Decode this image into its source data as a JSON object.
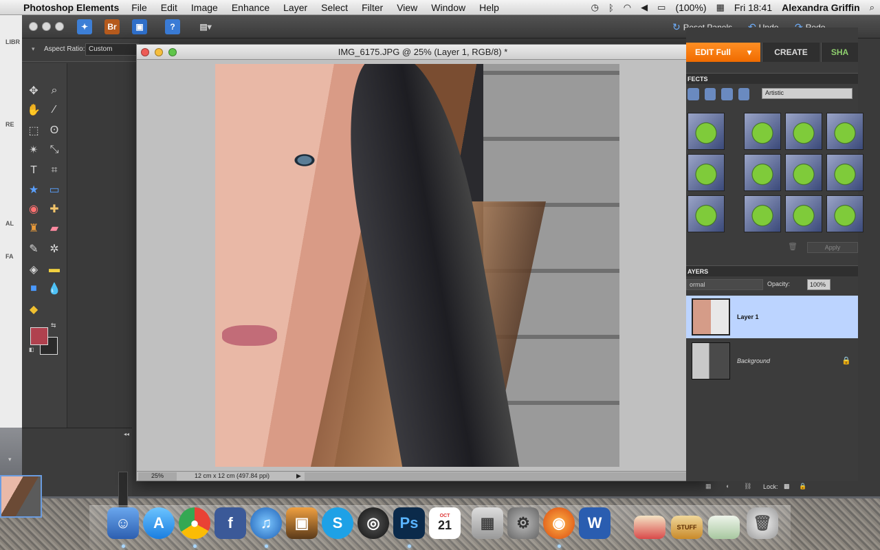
{
  "menubar": {
    "app_name": "Photoshop Elements",
    "items": [
      "File",
      "Edit",
      "Image",
      "Enhance",
      "Layer",
      "Select",
      "Filter",
      "View",
      "Window",
      "Help"
    ],
    "battery": "(100%)",
    "clock": "Fri 18:41",
    "user": "Alexandra Griffin"
  },
  "toolbar": {
    "reset_panels": "Reset Panels",
    "undo": "Undo",
    "redo": "Redo",
    "bridge_label": "Br"
  },
  "options": {
    "aspect_label": "Aspect Ratio:",
    "aspect_value": "Custom"
  },
  "document": {
    "title": "IMG_6175.JPG @ 25% (Layer 1, RGB/8) *",
    "zoom": "25%",
    "info": "12 cm x 12 cm (497.84 ppi)"
  },
  "tabs": {
    "edit": "EDIT Full",
    "create": "CREATE",
    "share": "SHA"
  },
  "effects": {
    "title": "FECTS",
    "category": "Artistic",
    "apply": "Apply"
  },
  "layers": {
    "title": "AYERS",
    "blend_mode": "ormal",
    "opacity_label": "Opacity:",
    "opacity_value": "100%",
    "lock_label": "Lock:",
    "items": [
      {
        "name": "Layer 1"
      },
      {
        "name": "Background"
      }
    ]
  },
  "left_panels": {
    "libr": "LIBR",
    "re": "RE",
    "al": "AL",
    "fa": "FA"
  },
  "dock": {
    "calendar_month": "OCT",
    "calendar_day": "21",
    "stuff_label": "STUFF"
  },
  "colors": {
    "accent_orange": "#f07a10",
    "foreground_swatch": "#b0414e",
    "selected_layer": "#bcd4ff"
  }
}
